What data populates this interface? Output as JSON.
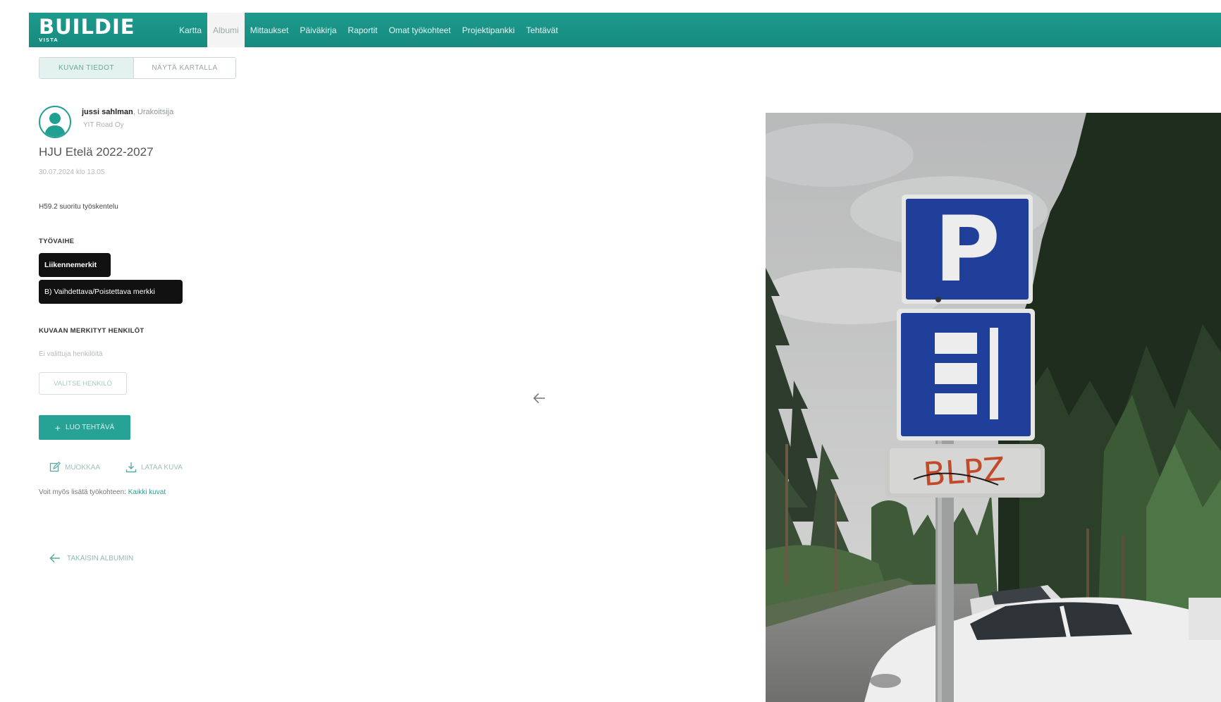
{
  "app": {
    "logo": "BUILDIE",
    "logo_sub": "VISTA"
  },
  "nav": {
    "items": [
      {
        "label": "Kartta"
      },
      {
        "label": "Albumi"
      },
      {
        "label": "Mittaukset"
      },
      {
        "label": "Päiväkirja"
      },
      {
        "label": "Raportit"
      },
      {
        "label": "Omat työkohteet"
      },
      {
        "label": "Projektipankki"
      },
      {
        "label": "Tehtävät"
      }
    ],
    "active_index": 1
  },
  "tabs": {
    "details": "KUVAN TIEDOT",
    "map": "NÄYTÄ KARTALLA"
  },
  "photo_info": {
    "user_name": "jussi sahlman",
    "user_role": ", Urakoitsija",
    "company": "YIT Road Oy",
    "project": "HJU Etelä 2022-2027",
    "date": "30.07.2024 klo 13.05",
    "description": "H59.2 suoritu työskentelu",
    "worktype_label": "TYÖVAIHE",
    "worktype_category": "Liikennemerkit",
    "worktype_item": "B) Vaihdettava/Poistettava merkki",
    "tagged_label": "KUVAAN MERKITYT HENKILÖT",
    "tagged_empty": "Ei valittuja henkilöitä",
    "select_people_btn": "VALITSE HENKILÖ",
    "add_task_btn": "LUO TEHTÄVÄ",
    "edit_label": "MUOKKAA",
    "download_label": "LATAA KUVA",
    "note_prefix": "Voit myös lisätä työkohteen:",
    "note_link": "Kaikki kuvat",
    "back_label": "TAKAISIN ALBUMIIN"
  },
  "photo": {
    "sign_letter": "P",
    "graffiti_text": "BLPZ"
  },
  "colors": {
    "brand": "#1e9b8e",
    "primary_button": "#27a395",
    "chip_bg": "#111111"
  }
}
